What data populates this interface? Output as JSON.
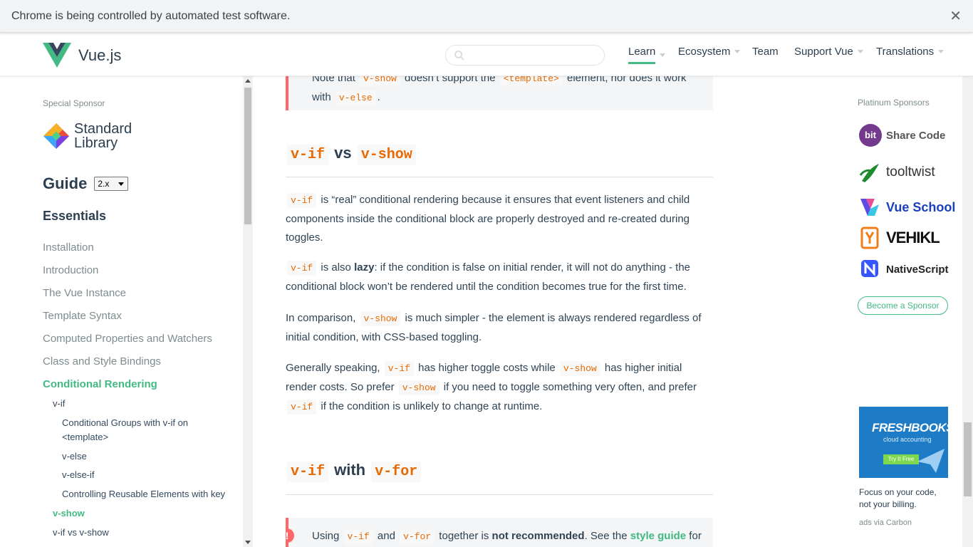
{
  "infobar": {
    "message": "Chrome is being controlled by automated test software.",
    "close": "✕"
  },
  "header": {
    "brand": "Vue.js",
    "search_placeholder": "",
    "nav": {
      "learn": "Learn",
      "ecosystem": "Ecosystem",
      "team": "Team",
      "support": "Support Vue",
      "translations": "Translations"
    }
  },
  "colors": {
    "accent": "#42b983",
    "code": "#e96900",
    "danger": "#ff6666",
    "text": "#2c3e50"
  },
  "sidebar": {
    "special_sponsor_label": "Special Sponsor",
    "sponsor_name_line1": "Standard",
    "sponsor_name_line2": "Library",
    "guide_title": "Guide",
    "version": "2.x",
    "section_title": "Essentials",
    "items": [
      "Installation",
      "Introduction",
      "The Vue Instance",
      "Template Syntax",
      "Computed Properties and Watchers",
      "Class and Style Bindings",
      "Conditional Rendering"
    ],
    "subitems": [
      "v-if",
      "Conditional Groups with v-if on",
      "<template>",
      "v-else",
      "v-else-if",
      "Controlling Reusable Elements with key",
      "v-show",
      "v-if vs v-show"
    ]
  },
  "content": {
    "tip1": {
      "t1": "Note that ",
      "c1": "v-show",
      "t2": " doesn’t support the ",
      "c2": "<template>",
      "t3": " element, nor does it work with ",
      "c3": "v-else",
      "t4": "."
    },
    "h2a": {
      "c1": "v-if",
      "mid": " vs ",
      "c2": "v-show"
    },
    "p1": {
      "c1": "v-if",
      "t1": " is “real” conditional rendering because it ensures that event listeners and child components inside the conditional block are properly destroyed and re-created during toggles."
    },
    "p2": {
      "c1": "v-if",
      "t1": " is also ",
      "b1": "lazy",
      "t2": ": if the condition is false on initial render, it will not do anything - the conditional block won’t be rendered until the condition becomes true for the first time."
    },
    "p3": {
      "t1": "In comparison, ",
      "c1": "v-show",
      "t2": " is much simpler - the element is always rendered regardless of initial condition, with CSS-based toggling."
    },
    "p4": {
      "t1": "Generally speaking, ",
      "c1": "v-if",
      "t2": " has higher toggle costs while ",
      "c2": "v-show",
      "t3": " has higher initial render costs. So prefer ",
      "c3": "v-show",
      "t4": " if you need to toggle something very often, and prefer ",
      "c4": "v-if",
      "t5": " if the condition is unlikely to change at runtime."
    },
    "h2b": {
      "c1": "v-if",
      "mid": " with ",
      "c2": "v-for"
    },
    "tip2": {
      "t1": "Using ",
      "c1": "v-if",
      "t2": " and ",
      "c2": "v-for",
      "t3": " together is ",
      "b1": "not recommended",
      "t4": ". See the ",
      "link": "style guide",
      "t5": " for"
    }
  },
  "right": {
    "platinum_label": "Platinum Sponsors",
    "sponsors": [
      "Share Code",
      "tooltwist",
      "Vue School",
      "VEHIKL",
      "NativeScript"
    ],
    "bit_badge": "bit",
    "become": "Become a Sponsor",
    "ad": {
      "title": "FRESHBOOKS",
      "subtitle": "cloud accounting",
      "cta": "Try It Free",
      "text": "Focus on your code, not your billing.",
      "via": "ads via Carbon"
    }
  }
}
